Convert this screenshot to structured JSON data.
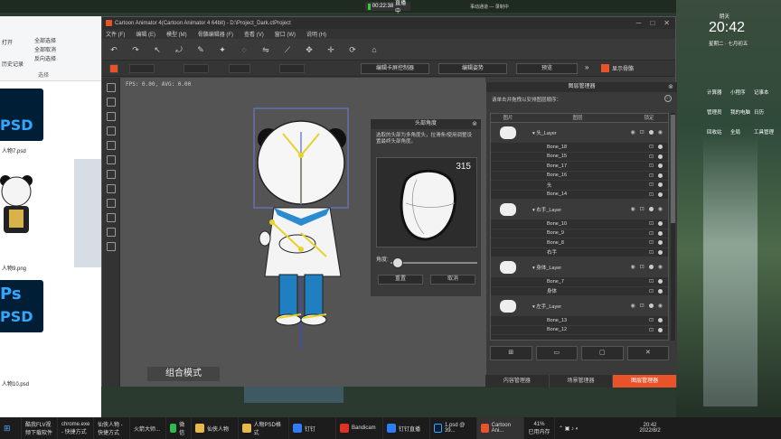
{
  "screen": {
    "recording_time": "00:22:38",
    "recording_label": "直播中",
    "top_right_text": "事动通道 — 录制中"
  },
  "explorer": {
    "ribbon": [
      "打开",
      "全部选择",
      "全部取消",
      "反向选择",
      "历史记录"
    ],
    "ribbon_group": "选择",
    "thumbs": [
      {
        "label": "人物7.psd",
        "type": "psd"
      },
      {
        "label": "人物9.png",
        "type": "png"
      },
      {
        "label": "人物10.psd",
        "type": "psd"
      }
    ],
    "psd_text": "PSD",
    "ps_text": "Ps"
  },
  "ca": {
    "title": "Cartoon Animator 4(Cartoon Animator 4 64bit) - D:\\Project_Dark.ctProject",
    "menu": [
      "文件 (F)",
      "编辑 (E)",
      "模型 (M)",
      "骨骼编辑器 (F)",
      "查看 (V)",
      "窗口 (W)",
      "说明 (H)"
    ],
    "toolbar2_buttons": [
      "编辑卡屏控制器",
      "编辑姿势",
      "预览"
    ],
    "show_bones": "显示骨骼",
    "fps": "FPS: 0.00, AVG: 0.00",
    "mode_label": "组合模式",
    "head_dialog": {
      "title": "头部角度",
      "desc": "选取的头部为多角度头，拉滑条/使用调整设置最终头部角度。",
      "value": "315",
      "angle_label": "角度:",
      "reset": "重置",
      "cancel": "取消"
    },
    "layer_panel": {
      "title": "图层管理器",
      "desc": "请单击并拖拽以安排图层顺序：",
      "columns": [
        "图片",
        "图层",
        "锁定"
      ],
      "rows": [
        {
          "kind": "group",
          "name": "头_Layer"
        },
        {
          "kind": "child",
          "name": "Bone_18"
        },
        {
          "kind": "child",
          "name": "Bone_15"
        },
        {
          "kind": "child",
          "name": "Bone_17"
        },
        {
          "kind": "child",
          "name": "Bone_16"
        },
        {
          "kind": "child",
          "name": "头"
        },
        {
          "kind": "child",
          "name": "Bone_14"
        },
        {
          "kind": "group",
          "name": "右手_Layer"
        },
        {
          "kind": "child",
          "name": "Bone_10"
        },
        {
          "kind": "child",
          "name": "Bone_9"
        },
        {
          "kind": "child",
          "name": "Bone_8"
        },
        {
          "kind": "child",
          "name": "右手"
        },
        {
          "kind": "group",
          "name": "身体_Layer"
        },
        {
          "kind": "child",
          "name": "Bone_7"
        },
        {
          "kind": "child",
          "name": "身体"
        },
        {
          "kind": "group",
          "name": "左手_Layer"
        },
        {
          "kind": "child",
          "name": "Bone_13"
        },
        {
          "kind": "child",
          "name": "Bone_12"
        }
      ]
    },
    "bottom_tabs": [
      "内容管理器",
      "场景管理器",
      "图层管理器"
    ]
  },
  "desktop": {
    "clock": "20:42",
    "date": "星期二 · 七月初五",
    "labels": [
      "计算器",
      "小程序",
      "记事本",
      "管理员",
      "我的电脑",
      "日历",
      "回收站",
      "全局",
      "工具管理"
    ],
    "weather": "阴天"
  },
  "taskbar": {
    "items": [
      "酷我FLV视频下载软件",
      "chrome.exe - 快捷方式",
      "仙侠人物 - 快捷方式",
      "火箭大师...",
      "微信",
      "仙侠人物",
      "人物PSD格式",
      "钉钉",
      "Bandicam",
      "钉钉直播",
      "1.psd @ 39...",
      "Cartoon Ani..."
    ],
    "cpu": "41%",
    "cpu_label": "已用内存",
    "time": "20:42",
    "date": "2022/8/2"
  }
}
